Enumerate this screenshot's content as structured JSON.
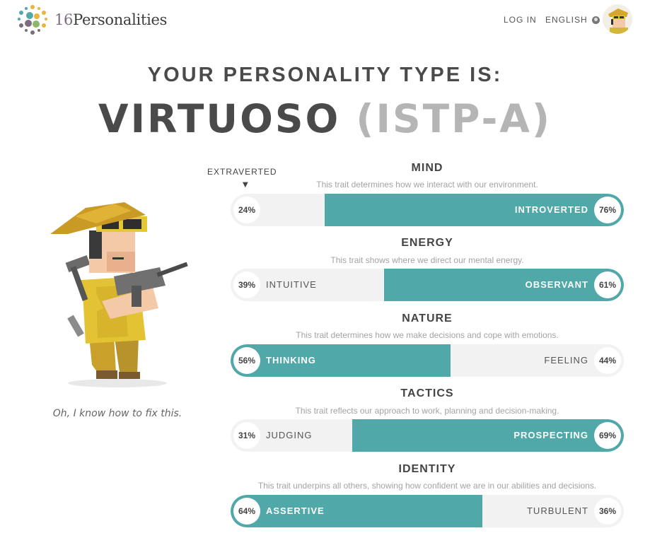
{
  "header": {
    "logo_num": "16",
    "logo_rest": "Personalities",
    "login": "LOG IN",
    "language": "ENGLISH"
  },
  "result": {
    "intro": "YOUR PERSONALITY TYPE IS:",
    "type_name": "VIRTUOSO",
    "type_code": "(ISTP-A)"
  },
  "character": {
    "quote": "Oh, I know how to fix this."
  },
  "extraverted_marker": "EXTRAVERTED",
  "colors": {
    "accent": "#51a8a9",
    "track": "#f2f2f2"
  },
  "traits": [
    {
      "title": "MIND",
      "desc": "This trait determines how we interact with our environment.",
      "left_pct": "24%",
      "left_label": "",
      "right_pct": "76%",
      "right_label": "INTROVERTED",
      "dominant": "right",
      "dominant_value": 76
    },
    {
      "title": "ENERGY",
      "desc": "This trait shows where we direct our mental energy.",
      "left_pct": "39%",
      "left_label": "INTUITIVE",
      "right_pct": "61%",
      "right_label": "OBSERVANT",
      "dominant": "right",
      "dominant_value": 61
    },
    {
      "title": "NATURE",
      "desc": "This trait determines how we make decisions and cope with emotions.",
      "left_pct": "56%",
      "left_label": "THINKING",
      "right_pct": "44%",
      "right_label": "FEELING",
      "dominant": "left",
      "dominant_value": 56
    },
    {
      "title": "TACTICS",
      "desc": "This trait reflects our approach to work, planning and decision-making.",
      "left_pct": "31%",
      "left_label": "JUDGING",
      "right_pct": "69%",
      "right_label": "PROSPECTING",
      "dominant": "right",
      "dominant_value": 69
    },
    {
      "title": "IDENTITY",
      "desc": "This trait underpins all others, showing how confident we are in our abilities and decisions.",
      "left_pct": "64%",
      "left_label": "ASSERTIVE",
      "right_pct": "36%",
      "right_label": "TURBULENT",
      "dominant": "left",
      "dominant_value": 64
    }
  ]
}
